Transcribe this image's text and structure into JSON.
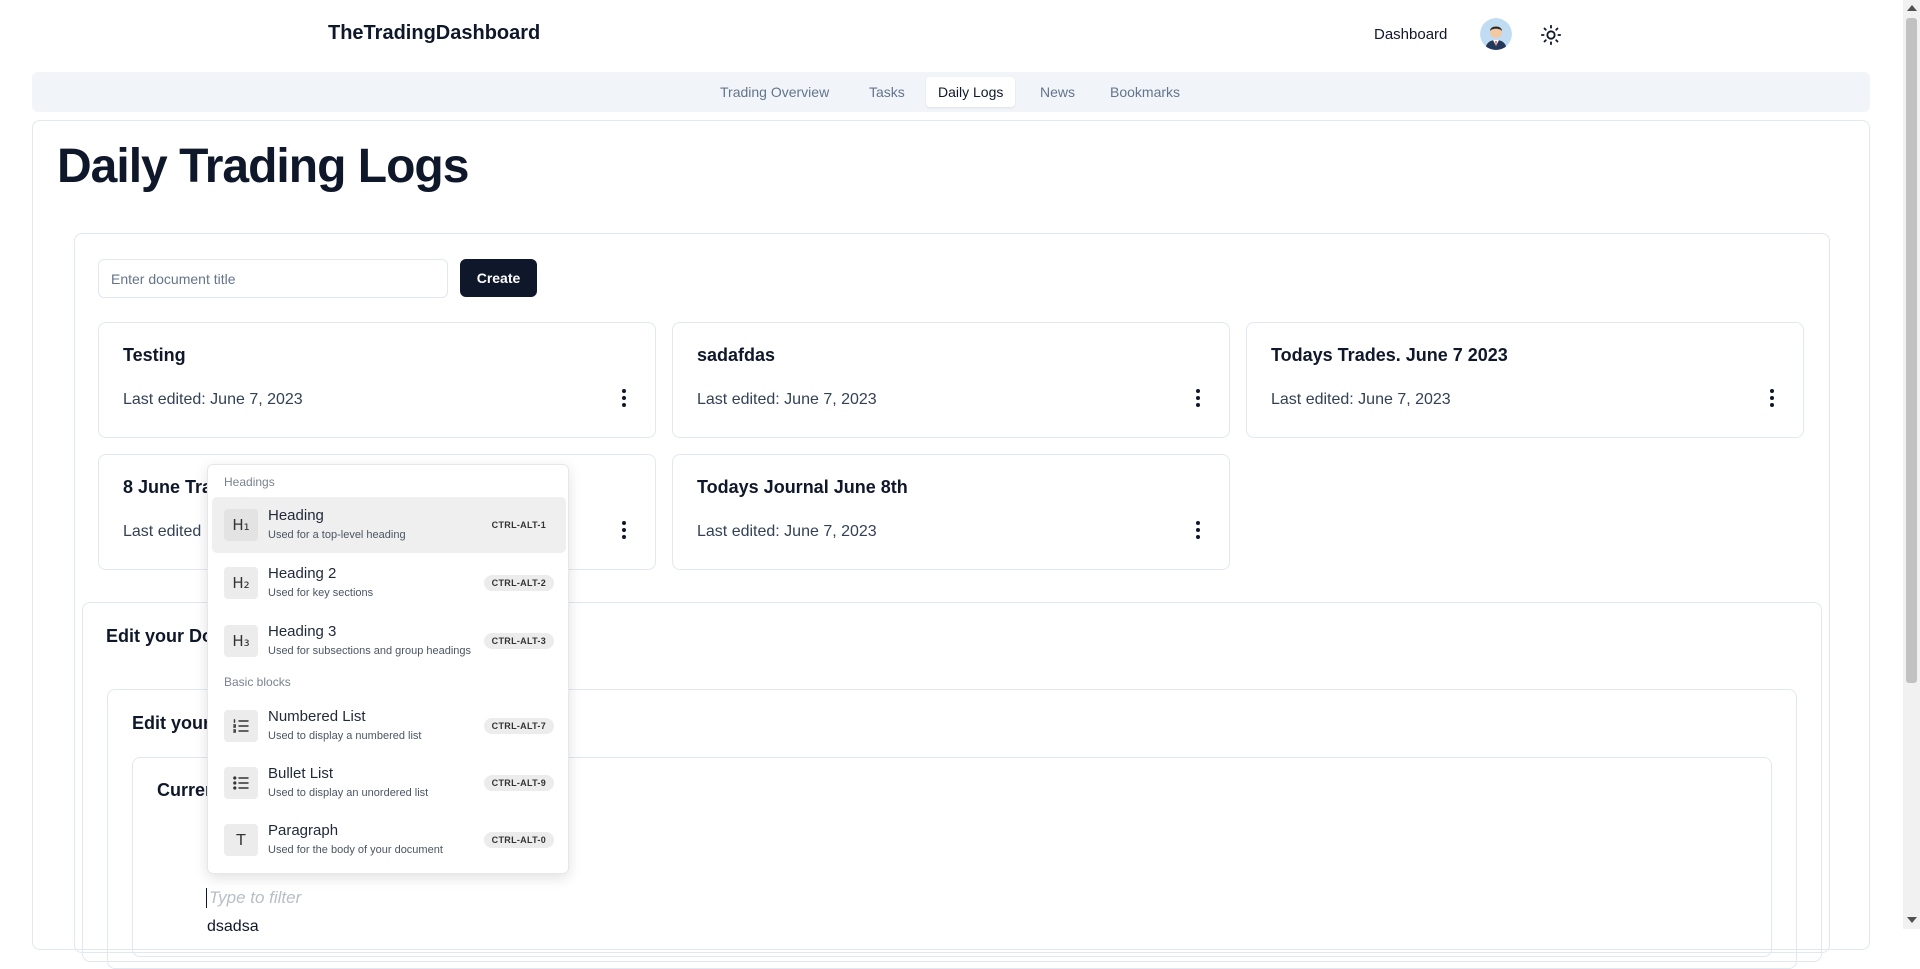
{
  "header": {
    "brand": "TheTradingDashboard",
    "dashboard_link": "Dashboard",
    "avatar_icon": "user-avatar-icon",
    "theme_icon": "sun-icon"
  },
  "nav": {
    "tabs": [
      {
        "label": "Trading Overview",
        "active": false
      },
      {
        "label": "Tasks",
        "active": false
      },
      {
        "label": "Daily Logs",
        "active": true
      },
      {
        "label": "News",
        "active": false
      },
      {
        "label": "Bookmarks",
        "active": false
      }
    ]
  },
  "page": {
    "title": "Daily Trading Logs"
  },
  "create": {
    "placeholder": "Enter document title",
    "button_label": "Create"
  },
  "documents": [
    {
      "title": "Testing",
      "edited": "Last edited: June 7, 2023"
    },
    {
      "title": "sadafdas",
      "edited": "Last edited: June 7, 2023"
    },
    {
      "title": "Todays Trades. June 7 2023",
      "edited": "Last edited: June 7, 2023"
    },
    {
      "title": "8 June Tra",
      "edited": "Last edited"
    },
    {
      "title": "Todays Journal June 8th",
      "edited": "Last edited: June 7, 2023"
    }
  ],
  "editor": {
    "section_label": "Edit your Do",
    "inner_label": "Edit your",
    "editor_label": "Curren",
    "filter_placeholder": "Type to filter",
    "content_text": "dsadsa"
  },
  "slash_menu": {
    "groups": [
      {
        "label": "Headings",
        "items": [
          {
            "icon_text": "H₁",
            "icon": "heading-1-icon",
            "title": "Heading",
            "subtitle": "Used for a top-level heading",
            "shortcut": "CTRL-ALT-1",
            "highlighted": true
          },
          {
            "icon_text": "H₂",
            "icon": "heading-2-icon",
            "title": "Heading 2",
            "subtitle": "Used for key sections",
            "shortcut": "CTRL-ALT-2",
            "highlighted": false
          },
          {
            "icon_text": "H₃",
            "icon": "heading-3-icon",
            "title": "Heading 3",
            "subtitle": "Used for subsections and group headings",
            "shortcut": "CTRL-ALT-3",
            "highlighted": false
          }
        ]
      },
      {
        "label": "Basic blocks",
        "items": [
          {
            "icon_text": "☷",
            "icon": "numbered-list-icon",
            "title": "Numbered List",
            "subtitle": "Used to display a numbered list",
            "shortcut": "CTRL-ALT-7",
            "highlighted": false
          },
          {
            "icon_text": "☰",
            "icon": "bullet-list-icon",
            "title": "Bullet List",
            "subtitle": "Used to display an unordered list",
            "shortcut": "CTRL-ALT-9",
            "highlighted": false
          },
          {
            "icon_text": "T",
            "icon": "paragraph-icon",
            "title": "Paragraph",
            "subtitle": "Used for the body of your document",
            "shortcut": "CTRL-ALT-0",
            "highlighted": false
          }
        ]
      }
    ]
  }
}
